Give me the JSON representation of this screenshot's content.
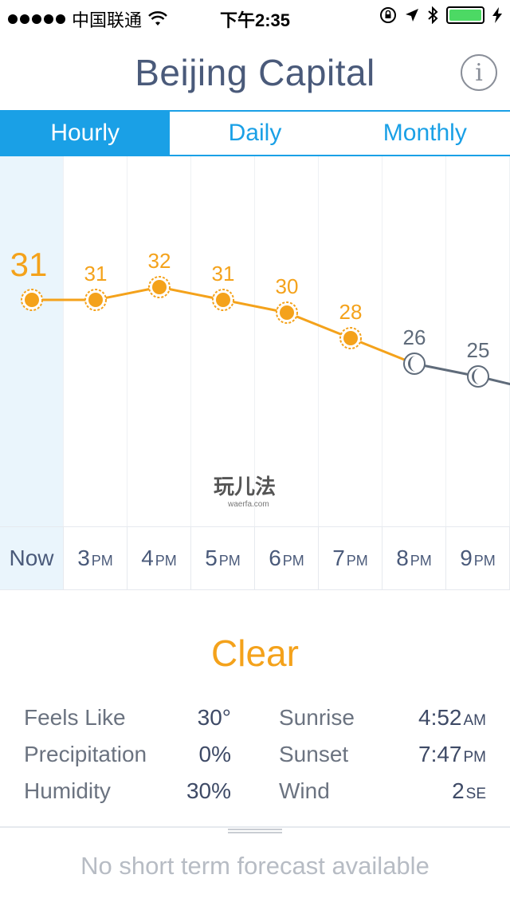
{
  "status": {
    "carrier": "中国联通",
    "time": "下午2:35"
  },
  "header": {
    "title": "Beijing Capital",
    "info_icon": "i"
  },
  "tabs": [
    {
      "label": "Hourly",
      "active": true
    },
    {
      "label": "Daily",
      "active": false
    },
    {
      "label": "Monthly",
      "active": false
    }
  ],
  "chart_data": {
    "type": "line",
    "categories": [
      "Now",
      "3PM",
      "4PM",
      "5PM",
      "6PM",
      "7PM",
      "8PM",
      "9PM"
    ],
    "values": [
      31,
      31,
      32,
      31,
      30,
      28,
      26,
      25
    ],
    "icons": [
      "sun",
      "sun",
      "sun",
      "sun",
      "sun",
      "sun",
      "moon",
      "moon"
    ],
    "colors": {
      "day": "#f4a21b",
      "night": "#5f6b7a"
    }
  },
  "hours": [
    {
      "num": "Now",
      "suffix": ""
    },
    {
      "num": "3",
      "suffix": "PM"
    },
    {
      "num": "4",
      "suffix": "PM"
    },
    {
      "num": "5",
      "suffix": "PM"
    },
    {
      "num": "6",
      "suffix": "PM"
    },
    {
      "num": "7",
      "suffix": "PM"
    },
    {
      "num": "8",
      "suffix": "PM"
    },
    {
      "num": "9",
      "suffix": "PM"
    }
  ],
  "watermark": {
    "text": "玩儿法",
    "sub": "waerfa.com"
  },
  "condition": "Clear",
  "details": {
    "feels_like": {
      "label": "Feels Like",
      "value": "30°"
    },
    "precipitation": {
      "label": "Precipitation",
      "value": "0%"
    },
    "humidity": {
      "label": "Humidity",
      "value": "30%"
    },
    "sunrise": {
      "label": "Sunrise",
      "value": "4:52",
      "suffix": "AM"
    },
    "sunset": {
      "label": "Sunset",
      "value": "7:47",
      "suffix": "PM"
    },
    "wind": {
      "label": "Wind",
      "value": "2",
      "suffix": "SE"
    }
  },
  "forecast_message": "No short term forecast available"
}
